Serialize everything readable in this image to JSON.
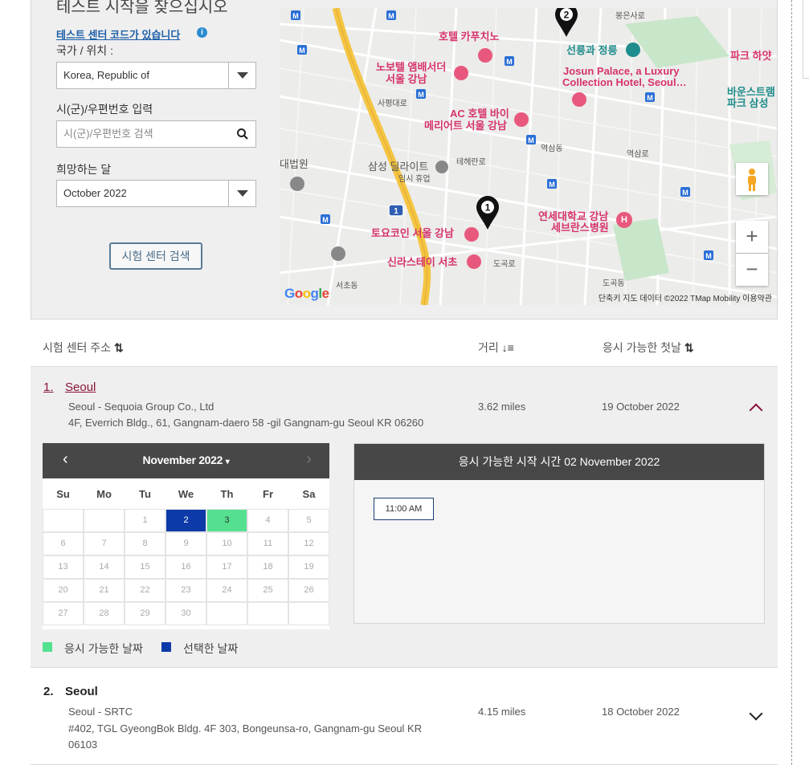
{
  "search": {
    "heading_cut": "테스트 시작을 찾으십시오",
    "code_link": "테스트 센터 코드가 있습니다",
    "info_icon": "i",
    "country_label": "국가 / 위치 :",
    "country_value": "Korea, Republic of",
    "city_label": "시(군)/우편번호 입력",
    "city_placeholder": "시(군)/우편번호 검색",
    "month_label": "희망하는 달",
    "month_value": "October 2022",
    "find_button": "시험 센터 검색"
  },
  "map": {
    "labels": [
      {
        "text": "호텔 카푸치노",
        "cls": ""
      },
      {
        "text": "노보텔 앰배서더",
        "cls": ""
      },
      {
        "text": "서울 강남",
        "cls": ""
      },
      {
        "text": "선릉과 정릉",
        "cls": "teal"
      },
      {
        "text": "Josun Palace, a Luxury",
        "cls": ""
      },
      {
        "text": "Collection Hotel, Seoul…",
        "cls": ""
      },
      {
        "text": "파크 하얏",
        "cls": ""
      },
      {
        "text": "바운스트램",
        "cls": "teal"
      },
      {
        "text": "파크 삼성",
        "cls": "teal"
      },
      {
        "text": "AC 호텔 바이",
        "cls": ""
      },
      {
        "text": "메리어트 서울 강남",
        "cls": ""
      },
      {
        "text": "삼성 딜라이트",
        "cls": "grey"
      },
      {
        "text": "임시 휴업",
        "cls": "small"
      },
      {
        "text": "대법원",
        "cls": "grey"
      },
      {
        "text": "연세대학교 강남",
        "cls": ""
      },
      {
        "text": "세브란스병원",
        "cls": ""
      },
      {
        "text": "토요코인 서울 강남",
        "cls": ""
      },
      {
        "text": "신라스테이 서초",
        "cls": ""
      },
      {
        "text": "역삼동",
        "cls": "small"
      },
      {
        "text": "역삼로",
        "cls": "small"
      },
      {
        "text": "테헤란로",
        "cls": "small"
      },
      {
        "text": "도곡로",
        "cls": "small"
      },
      {
        "text": "서초동",
        "cls": "small"
      },
      {
        "text": "도곡동",
        "cls": "small"
      },
      {
        "text": "봉은사로",
        "cls": "small"
      },
      {
        "text": "사평대로",
        "cls": "small"
      }
    ],
    "pin1": "1",
    "pin2": "2",
    "highway": "1",
    "zoom_in": "+",
    "zoom_out": "−",
    "footer": "단축키   지도 데이터 ©2022 TMap Mobility   이용약관",
    "logo": "Google"
  },
  "results_header": {
    "address": "시험 센터 주소",
    "distance": "거리",
    "first_date": "응시 가능한 첫날"
  },
  "results": [
    {
      "num": "1.",
      "city": "Seoul",
      "name": "Seoul - Sequoia Group Co., Ltd",
      "address": "4F, Everrich Bldg., 61, Gangnam-daero 58 -gil Gangnam-gu Seoul KR 06260",
      "distance": "3.62 miles",
      "date": "19 October 2022"
    },
    {
      "num": "2.",
      "city": "Seoul",
      "name": "Seoul - SRTC",
      "address_line1": "#402, TGL GyeongBok Bldg. 4F 303, Bongeunsa-ro, Gangnam-gu Seoul KR",
      "address_line2": "06103",
      "distance": "4.15 miles",
      "date": "18 October 2022"
    }
  ],
  "calendar": {
    "title": "November 2022",
    "dow": [
      "Su",
      "Mo",
      "Tu",
      "We",
      "Th",
      "Fr",
      "Sa"
    ],
    "weeks": [
      [
        "",
        "",
        "1",
        "2",
        "3",
        "4",
        "5"
      ],
      [
        "6",
        "7",
        "8",
        "9",
        "10",
        "11",
        "12"
      ],
      [
        "13",
        "14",
        "15",
        "16",
        "17",
        "18",
        "19"
      ],
      [
        "20",
        "21",
        "22",
        "23",
        "24",
        "25",
        "26"
      ],
      [
        "27",
        "28",
        "29",
        "30",
        "",
        "",
        ""
      ]
    ],
    "selected_day": "2",
    "available_days": [
      "3"
    ],
    "colors": {
      "available": "#55e08f",
      "selected": "#0d3aa8"
    }
  },
  "legend": {
    "available": "응시 가능한 날짜",
    "selected": "선택한 날짜"
  },
  "times": {
    "header": "응시 가능한 시작 시간 02 November 2022",
    "slots": [
      "11:00 AM"
    ]
  }
}
